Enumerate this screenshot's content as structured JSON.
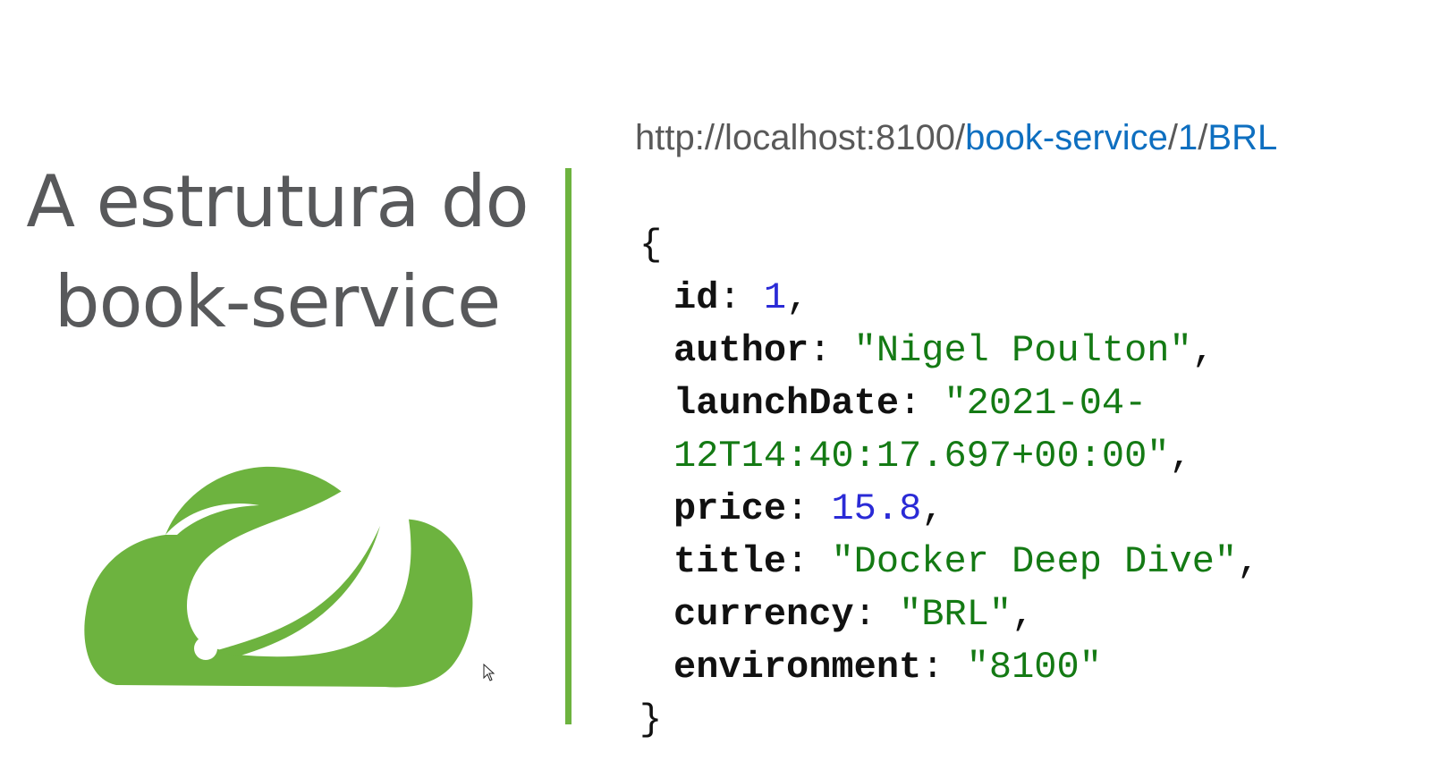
{
  "title": {
    "line1": "A estrutura do",
    "line2": "book-service"
  },
  "url": {
    "base": "http://localhost:8100/",
    "path1": "book-service",
    "sep1": "/",
    "path2": "1",
    "sep2": "/",
    "path3": "BRL"
  },
  "json": {
    "open": "{",
    "close": "}",
    "id_key": "id",
    "id_value": "1",
    "author_key": "author",
    "author_value": "\"Nigel Poulton\"",
    "launchDate_key": "launchDate",
    "launchDate_value_part1": "\"2021-04-",
    "launchDate_value_part2": "12T14:40:17.697+00:00\"",
    "price_key": "price",
    "price_value": "15.8",
    "title_key": "title",
    "title_value": "\"Docker Deep Dive\"",
    "currency_key": "currency",
    "currency_value": "\"BRL\"",
    "environment_key": "environment",
    "environment_value": "\"8100\""
  },
  "colors": {
    "brand_green": "#6db33f",
    "title_gray": "#58595b",
    "url_link_blue": "#0e6fc0",
    "number_blue": "#2a2ad6",
    "string_green": "#147a14"
  },
  "icons": {
    "logo": "spring-cloud-logo-icon",
    "cursor": "mouse-pointer-icon"
  }
}
